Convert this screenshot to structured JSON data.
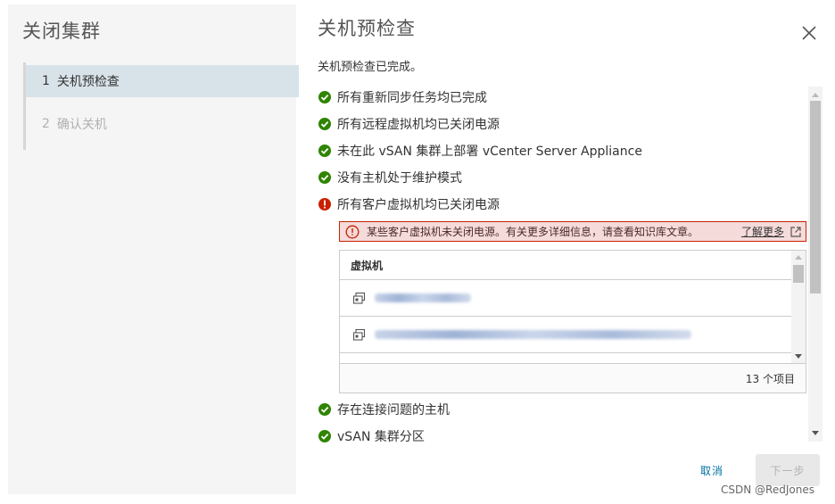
{
  "wizard": {
    "title": "关闭集群",
    "steps": [
      {
        "num": "1",
        "label": "关机预检查"
      },
      {
        "num": "2",
        "label": "确认关机"
      }
    ]
  },
  "page": {
    "title": "关机预检查",
    "summary": "关机预检查已完成。"
  },
  "checks": [
    {
      "label": "所有重新同步任务均已完成",
      "status": "pass"
    },
    {
      "label": "所有远程虚拟机均已关闭电源",
      "status": "pass"
    },
    {
      "label": "未在此 vSAN 集群上部署 vCenter Server Appliance",
      "status": "pass"
    },
    {
      "label": "没有主机处于维护模式",
      "status": "pass"
    },
    {
      "label": "所有客户虚拟机均已关闭电源",
      "status": "fail"
    },
    {
      "label": "存在连接问题的主机",
      "status": "pass"
    },
    {
      "label": "vSAN 集群分区",
      "status": "pass"
    }
  ],
  "alert": {
    "text": "某些客户虚拟机未关闭电源。有关更多详细信息，请查看知识库文章。",
    "link": "了解更多"
  },
  "grid": {
    "column": "虚拟机",
    "footer": "13 个项目"
  },
  "buttons": {
    "cancel": "取消",
    "next": "下一步"
  },
  "watermark": "CSDN @RedJones",
  "colors": {
    "success": "#2f8400",
    "danger": "#c92100",
    "link": "#0072a3"
  }
}
